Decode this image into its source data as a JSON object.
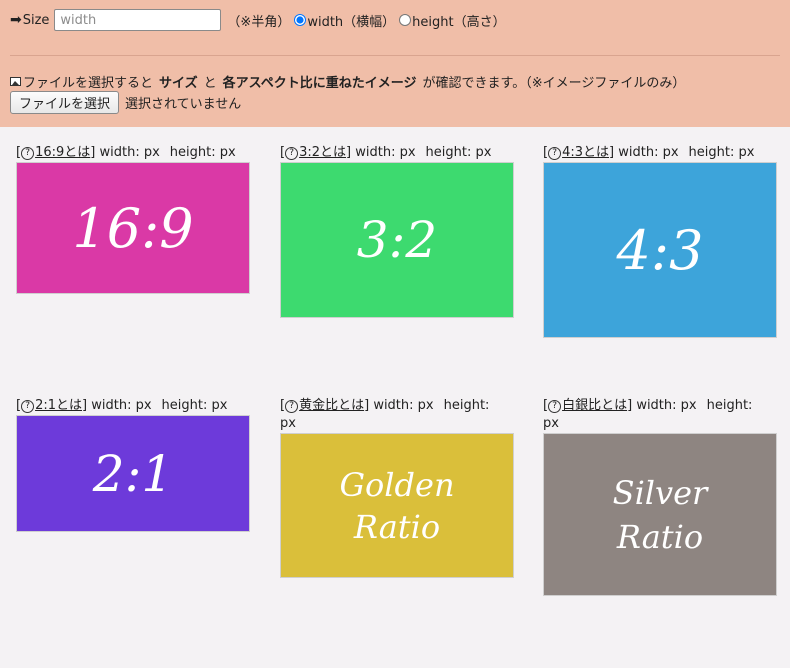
{
  "size_row": {
    "arrow": "➡",
    "label": "Size",
    "input_placeholder": "width",
    "note": "（※半角）",
    "radio_width": "width（横幅）",
    "radio_height": "height（高さ）"
  },
  "desc_row": {
    "text1": "ファイルを選択すると",
    "bold1": "サイズ",
    "text2": "と",
    "bold2": "各アスペクト比に重ねたイメージ",
    "text3": "が確認できます。（※イメージファイルのみ）"
  },
  "file_row": {
    "button_label": "ファイルを選択",
    "status": "選択されていません"
  },
  "cards": [
    {
      "link": "16:9とは",
      "width_label": "width: px",
      "height_label": "height: px",
      "box_text": "16:9",
      "color": "#da39a6"
    },
    {
      "link": "3:2とは",
      "width_label": "width: px",
      "height_label": "height: px",
      "box_text": "3:2",
      "color": "#3dda6f"
    },
    {
      "link": "4:3とは",
      "width_label": "width: px",
      "height_label": "height: px",
      "box_text": "4:3",
      "color": "#3da4da"
    },
    {
      "link": "2:1とは",
      "width_label": "width: px",
      "height_label": "height: px",
      "box_text": "2:1",
      "color": "#6d3ada"
    },
    {
      "link": "黄金比とは",
      "width_label": "width: px",
      "height_label": "height: px",
      "box_text": "Golden\nRatio",
      "color": "#dabf3a"
    },
    {
      "link": "白銀比とは",
      "width_label": "width: px",
      "height_label": "height: px",
      "box_text": "Silver\nRatio",
      "color": "#8e8581"
    }
  ]
}
